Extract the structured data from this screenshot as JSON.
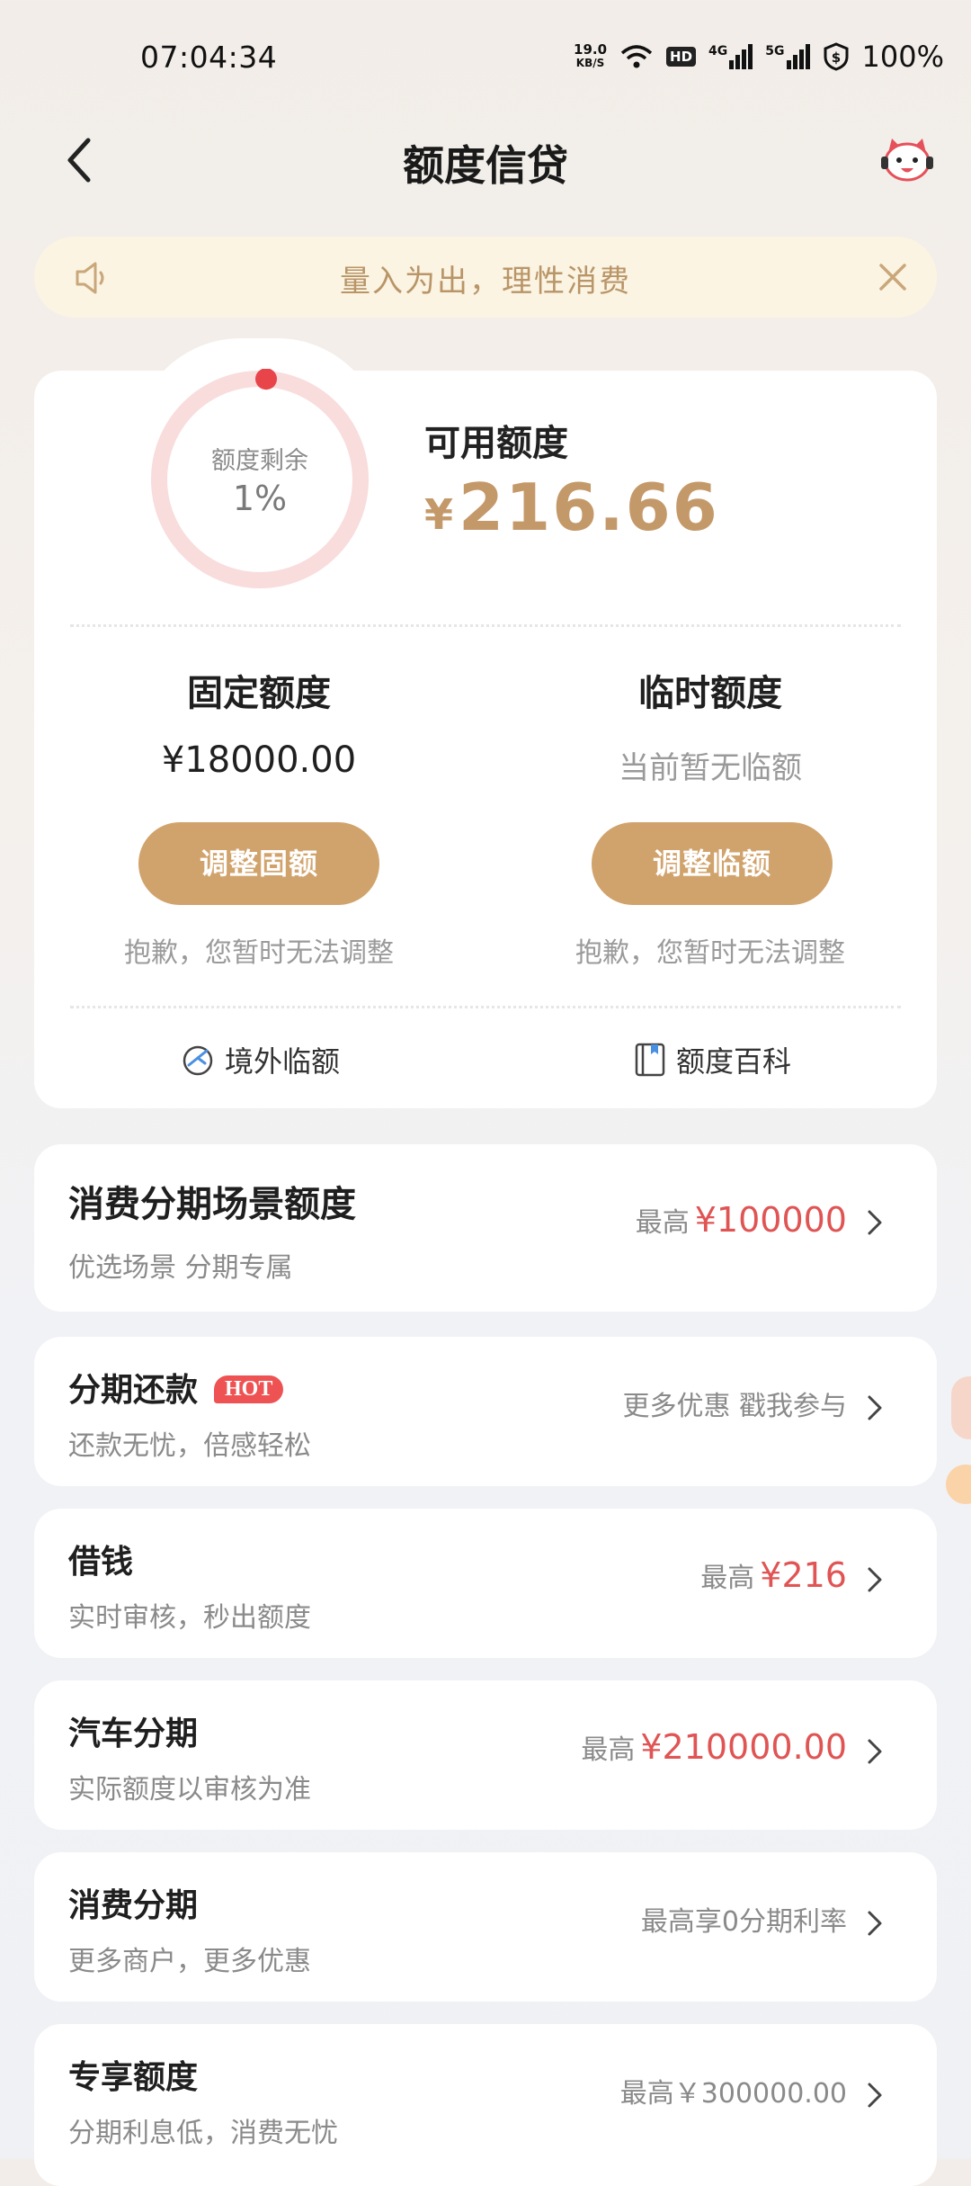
{
  "status_bar": {
    "time": "07:04:34",
    "net_speed_value": "19.0",
    "net_speed_unit": "KB/S",
    "hd_label": "HD",
    "net1_label": "4G",
    "net2_label": "5G",
    "battery": "100%"
  },
  "header": {
    "title": "额度信贷"
  },
  "notice": {
    "text": "量入为出，理性消费"
  },
  "quota": {
    "ring_label": "额度剩余",
    "ring_value": "1%",
    "ring_fraction": 0.01,
    "available_label": "可用额度",
    "available_currency": "¥",
    "available_value": "216.66",
    "fixed": {
      "title": "固定额度",
      "value": "¥18000.00",
      "button": "调整固额",
      "note": "抱歉，您暂时无法调整"
    },
    "temporary": {
      "title": "临时额度",
      "value": "当前暂无临额",
      "button": "调整临额",
      "note": "抱歉，您暂时无法调整"
    },
    "links": {
      "overseas": "境外临额",
      "wiki": "额度百科"
    }
  },
  "list": [
    {
      "title": "消费分期场景额度",
      "subtitle": "优选场景 分期专属",
      "right_prefix": "最高",
      "right_value": "¥100000"
    },
    {
      "title": "分期还款",
      "badge": "HOT",
      "subtitle": "还款无忧，倍感轻松",
      "right_text": "更多优惠 戳我参与"
    },
    {
      "title": "借钱",
      "subtitle": "实时审核，秒出额度",
      "right_prefix": "最高",
      "right_value": "¥216"
    },
    {
      "title": "汽车分期",
      "subtitle": "实际额度以审核为准",
      "right_prefix": "最高",
      "right_value": "¥210000.00"
    },
    {
      "title": "消费分期",
      "subtitle": "更多商户，更多优惠",
      "right_text": "最高享0分期利率"
    },
    {
      "title": "专享额度",
      "subtitle": "分期利息低，消费无忧",
      "right_text": "最高￥300000.00"
    }
  ],
  "colors": {
    "accent_gold": "#c4996a",
    "button_gold": "#d1a36c",
    "highlight_red": "#e05454",
    "ring_track": "#f9dcdc",
    "ring_dot": "#e8454b"
  }
}
